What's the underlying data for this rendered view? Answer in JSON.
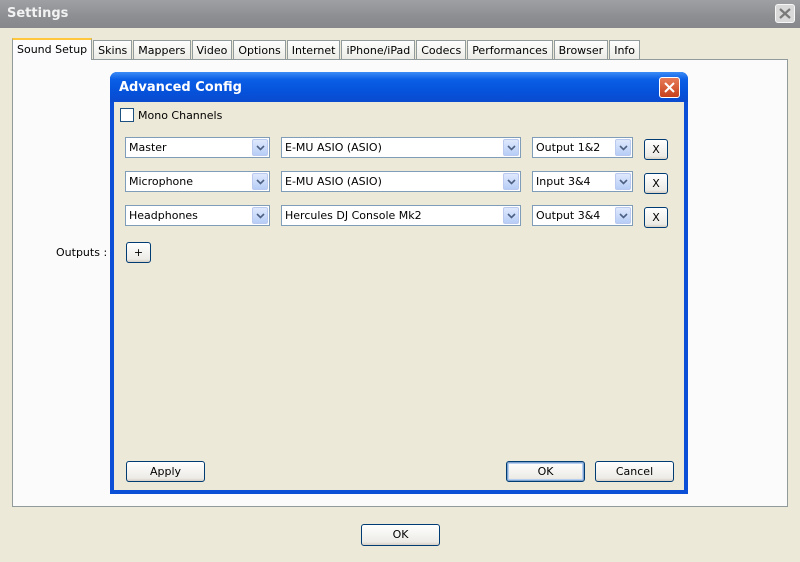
{
  "window": {
    "title": "Settings"
  },
  "tabs": [
    "Sound Setup",
    "Skins",
    "Mappers",
    "Video",
    "Options",
    "Internet",
    "iPhone/iPad",
    "Codecs",
    "Performances",
    "Browser",
    "Info"
  ],
  "active_tab": "Sound Setup",
  "panel": {
    "outputs_label": "Outputs :"
  },
  "footer": {
    "ok_label": "OK"
  },
  "dialog": {
    "title": "Advanced Config",
    "mono_channels": {
      "label": "Mono Channels",
      "checked": false
    },
    "rows": [
      {
        "channel": "Master",
        "device": "E-MU ASIO (ASIO)",
        "port": "Output 1&2",
        "remove_label": "X"
      },
      {
        "channel": "Microphone",
        "device": "E-MU ASIO (ASIO)",
        "port": "Input 3&4",
        "remove_label": "X"
      },
      {
        "channel": "Headphones",
        "device": "Hercules DJ Console Mk2",
        "port": "Output 3&4",
        "remove_label": "X"
      }
    ],
    "add_label": "+",
    "apply_label": "Apply",
    "ok_label": "OK",
    "cancel_label": "Cancel"
  },
  "colors": {
    "dialog_title": "#0a5ee6",
    "close_red": "#d6532f",
    "tab_highlight": "#ffc83c"
  },
  "icons": {
    "window_close": "close-icon",
    "combo_arrow": "chevron-down-icon"
  }
}
